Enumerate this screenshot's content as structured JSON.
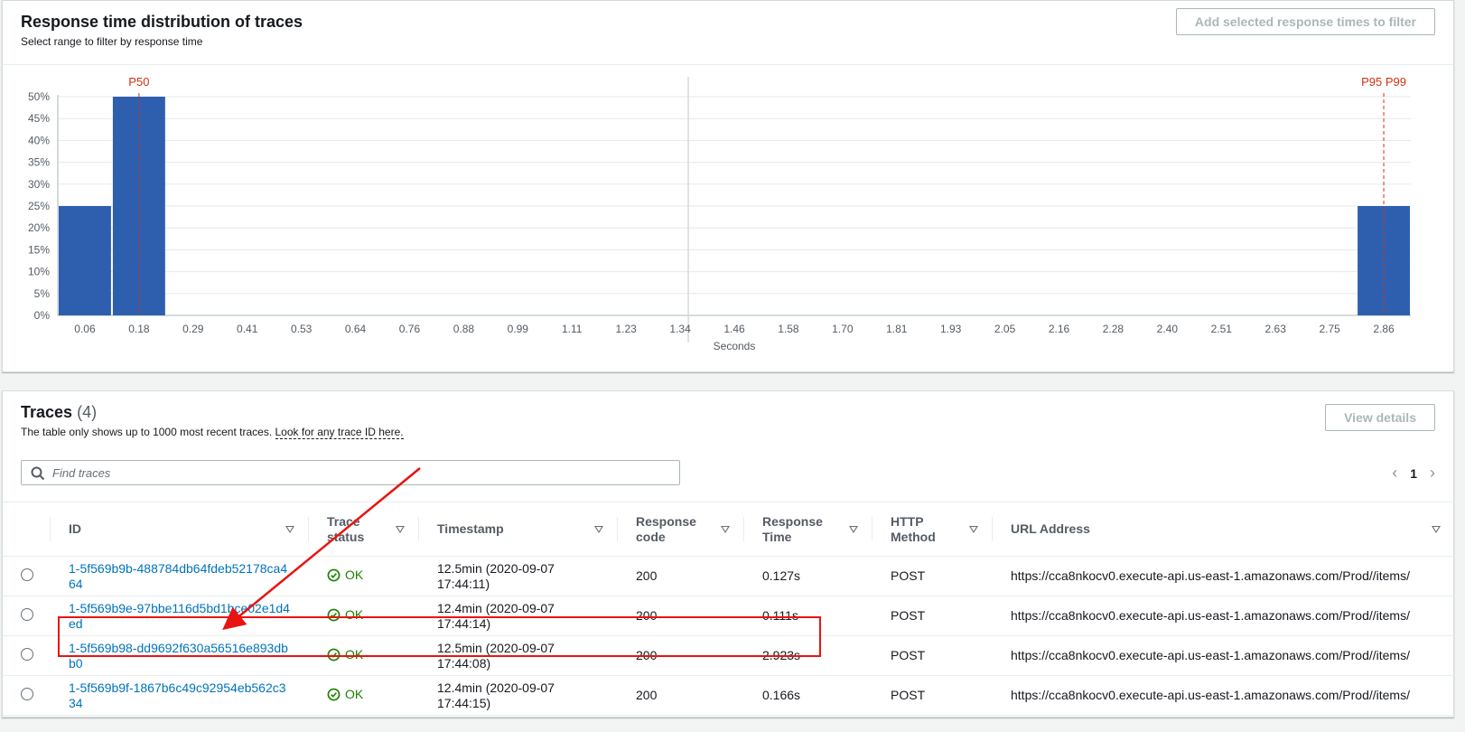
{
  "histogram": {
    "title": "Response time distribution of traces",
    "subtitle": "Select range to filter by response time",
    "add_filter_label": "Add selected response times to filter",
    "y_ticks": [
      "0%",
      "5%",
      "10%",
      "15%",
      "20%",
      "25%",
      "30%",
      "35%",
      "40%",
      "45%",
      "50%"
    ],
    "x_ticks": [
      "0.06",
      "0.18",
      "0.29",
      "0.41",
      "0.53",
      "0.64",
      "0.76",
      "0.88",
      "0.99",
      "1.11",
      "1.23",
      "1.34",
      "1.46",
      "1.58",
      "1.70",
      "1.81",
      "1.93",
      "2.05",
      "2.16",
      "2.28",
      "2.40",
      "2.51",
      "2.63",
      "2.75",
      "2.86"
    ],
    "xlabel": "Seconds",
    "markers": [
      {
        "label": "P50",
        "at_tick": 1
      },
      {
        "label": "P95 P99",
        "at_tick": 24
      }
    ],
    "marker_color": "#d13212",
    "bar_color": "#2e5faf"
  },
  "chart_data": {
    "type": "bar",
    "categories": [
      "0.06",
      "0.18",
      "0.29",
      "0.41",
      "0.53",
      "0.64",
      "0.76",
      "0.88",
      "0.99",
      "1.11",
      "1.23",
      "1.34",
      "1.46",
      "1.58",
      "1.70",
      "1.81",
      "1.93",
      "2.05",
      "2.16",
      "2.28",
      "2.40",
      "2.51",
      "2.63",
      "2.75",
      "2.86"
    ],
    "values": [
      25,
      50,
      0,
      0,
      0,
      0,
      0,
      0,
      0,
      0,
      0,
      0,
      0,
      0,
      0,
      0,
      0,
      0,
      0,
      0,
      0,
      0,
      0,
      0,
      25
    ],
    "title": "Response time distribution of traces",
    "xlabel": "Seconds",
    "ylabel": "",
    "ylim": [
      0,
      50
    ],
    "grid": true
  },
  "traces": {
    "title": "Traces",
    "count": "(4)",
    "note_text": "The table only shows up to 1000 most recent traces.",
    "note_link": "Look for any trace ID here.",
    "view_details_label": "View details",
    "search_placeholder": "Find traces",
    "page": "1",
    "columns": {
      "id": "ID",
      "status": "Trace status",
      "timestamp": "Timestamp",
      "code": "Response code",
      "time": "Response Time",
      "method": "HTTP Method",
      "url": "URL Address"
    },
    "rows": [
      {
        "id": "1-5f569b9b-488784db64fdeb52178ca464",
        "status": "OK",
        "timestamp": "12.5min (2020-09-07 17:44:11)",
        "code": "200",
        "time": "0.127s",
        "method": "POST",
        "url": "https://cca8nkocv0.execute-api.us-east-1.amazonaws.com/Prod//items/"
      },
      {
        "id": "1-5f569b9e-97bbe116d5bd1bce02e1d4ed",
        "status": "OK",
        "timestamp": "12.4min (2020-09-07 17:44:14)",
        "code": "200",
        "time": "0.111s",
        "method": "POST",
        "url": "https://cca8nkocv0.execute-api.us-east-1.amazonaws.com/Prod//items/"
      },
      {
        "id": "1-5f569b98-dd9692f630a56516e893dbb0",
        "status": "OK",
        "timestamp": "12.5min (2020-09-07 17:44:08)",
        "code": "200",
        "time": "2.923s",
        "method": "POST",
        "url": "https://cca8nkocv0.execute-api.us-east-1.amazonaws.com/Prod//items/"
      },
      {
        "id": "1-5f569b9f-1867b6c49c92954eb562c334",
        "status": "OK",
        "timestamp": "12.4min (2020-09-07 17:44:15)",
        "code": "200",
        "time": "0.166s",
        "method": "POST",
        "url": "https://cca8nkocv0.execute-api.us-east-1.amazonaws.com/Prod//items/"
      }
    ]
  },
  "annotation": {
    "color": "#e8140f",
    "highlighted_row": 2
  }
}
